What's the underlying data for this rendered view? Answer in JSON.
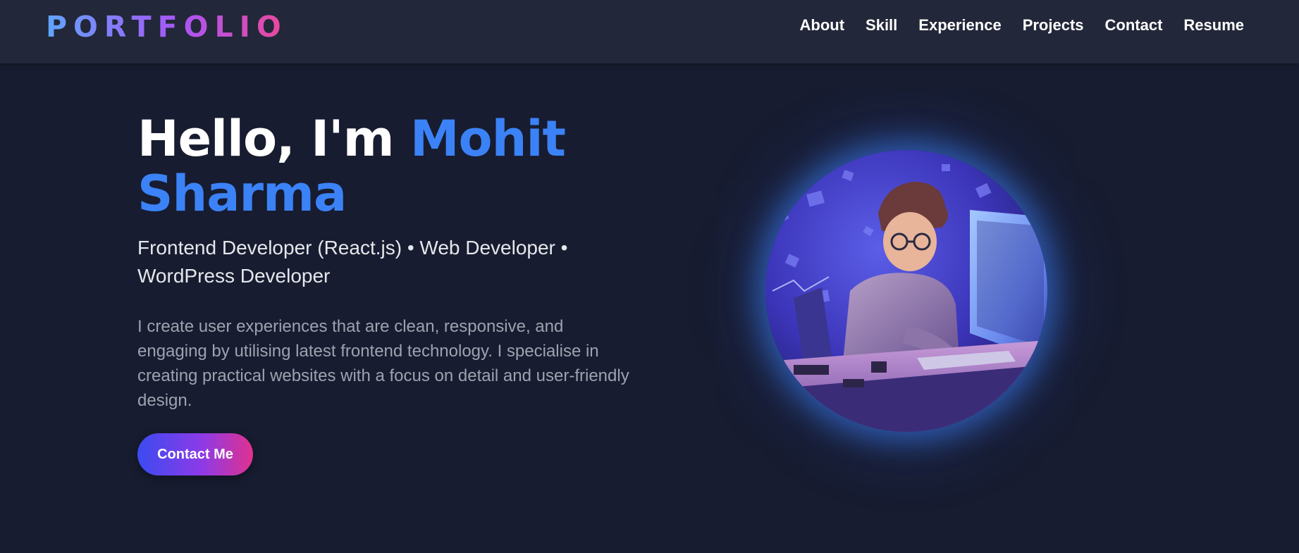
{
  "nav": {
    "logo": "PORTFOLIO",
    "links": [
      "About",
      "Skill",
      "Experience",
      "Projects",
      "Contact",
      "Resume"
    ]
  },
  "hero": {
    "greeting": "Hello, I'm ",
    "name": "Mohit Sharma",
    "subtitle": "Frontend Developer (React.js) • Web Developer • WordPress Developer",
    "description": "I create user experiences that are clean, responsive, and engaging by utilising latest frontend technology. I specialise in creating practical websites with a focus on detail and user-friendly design.",
    "cta_label": "Contact Me"
  },
  "colors": {
    "background": "#171c30",
    "navbar": "#222739",
    "accent_name": "#3b82f6",
    "logo_gradient": [
      "#60a5fa",
      "#a855f7",
      "#ec4899"
    ],
    "button_gradient": [
      "#3b4bf0",
      "#8b3be8",
      "#e0318f"
    ]
  },
  "illustration": {
    "subject": "developer-avatar-illustration"
  }
}
